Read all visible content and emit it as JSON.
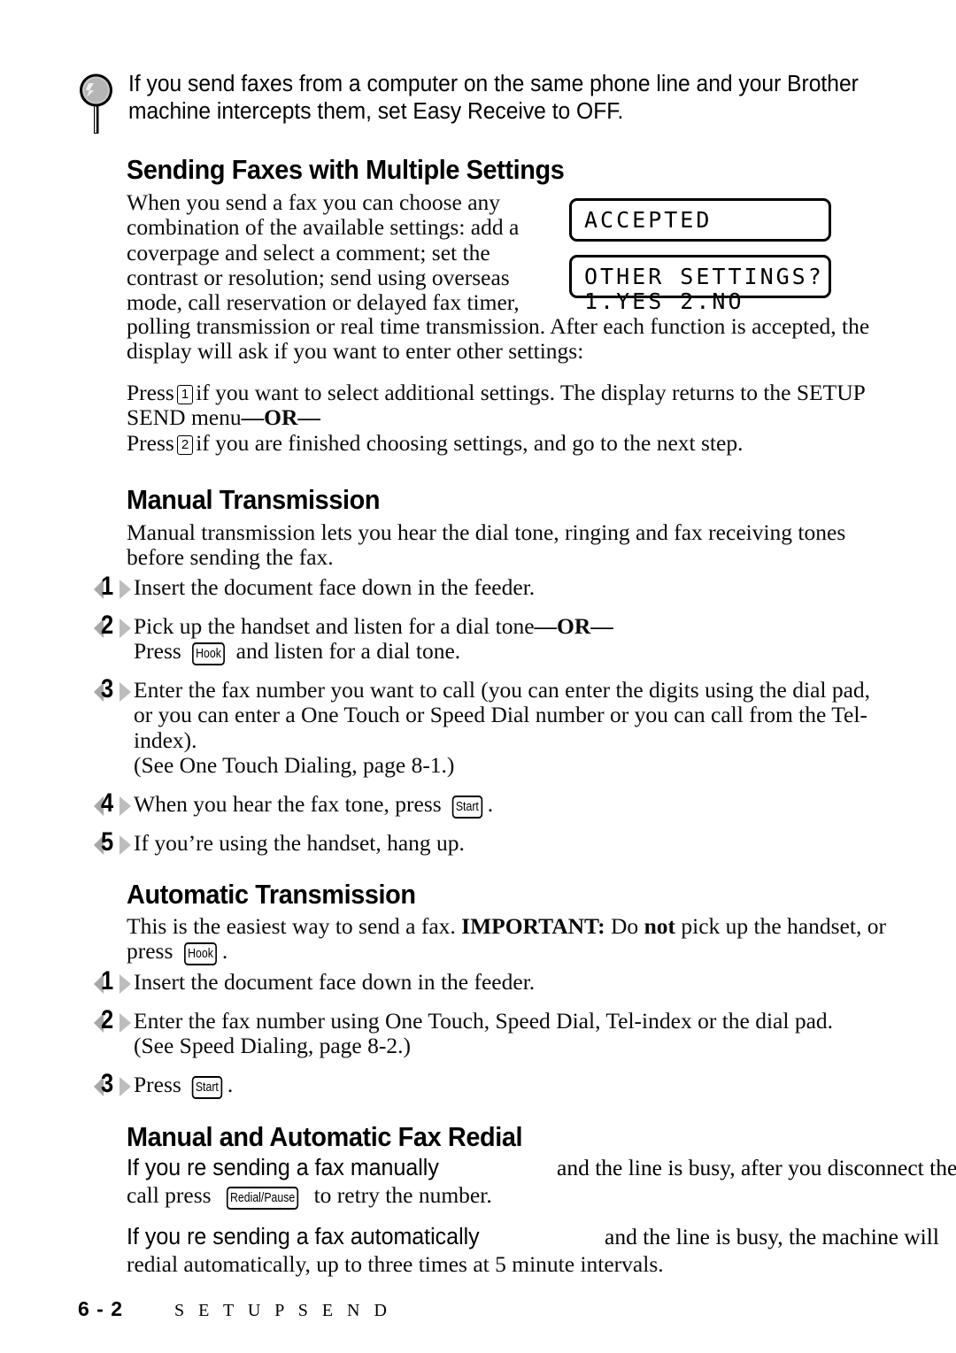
{
  "note": {
    "icon": "magnifier-icon",
    "lines": [
      "If you send faxes from a computer on the same phone line and your Brother",
      "machine intercepts them, set Easy Receive to OFF."
    ]
  },
  "sections": {
    "multiple_settings": {
      "heading": "Sending Faxes with Multiple Settings",
      "intro_narrow": "When you send a fax you can choose any combination of the available settings:  add a coverpage and select a comment; set the contrast or resolution; send using overseas mode, call reservation or delayed fax timer,",
      "intro_wide": "polling transmission or real time transmission. After each function is accepted, the display will ask if you want to enter other settings:",
      "press_1_pre": "Press",
      "press_1_key": "1",
      "press_1_post": "if you want to select additional settings. The display returns to the SETUP SEND menu",
      "or_label": "—OR—",
      "press_2_pre": "Press",
      "press_2_key": "2",
      "press_2_post": "if you are finished choosing settings, and go to the next step."
    },
    "lcd_displays": [
      {
        "name": "accepted-display",
        "lines": [
          "ACCEPTED"
        ]
      },
      {
        "name": "other-settings-display",
        "lines": [
          "OTHER SETTINGS?",
          "1.YES 2.NO"
        ]
      }
    ],
    "manual_transmission": {
      "heading": "Manual Transmission",
      "intro": "Manual transmission lets you hear the dial tone, ringing and fax receiving tones before sending the fax.",
      "steps": [
        {
          "num": "1",
          "parts": [
            {
              "t": "text",
              "v": "Insert the document face down in the feeder."
            }
          ]
        },
        {
          "num": "2",
          "parts": [
            {
              "t": "text",
              "v": "Pick up the handset and listen for a dial tone"
            },
            {
              "t": "bold",
              "v": "—OR—"
            },
            {
              "t": "br"
            },
            {
              "t": "text",
              "v": "Press "
            },
            {
              "t": "key",
              "v": "Hook"
            },
            {
              "t": "text",
              "v": " and listen for a dial tone."
            }
          ]
        },
        {
          "num": "3",
          "parts": [
            {
              "t": "text",
              "v": "Enter the fax number you want to call (you can enter the digits using the dial pad, or you can enter a One Touch or Speed Dial number or you can call from the Tel-index)."
            },
            {
              "t": "br"
            },
            {
              "t": "text",
              "v": "(See One Touch Dialing, page 8-1.)"
            }
          ]
        },
        {
          "num": "4",
          "parts": [
            {
              "t": "text",
              "v": "When you hear the fax tone, press "
            },
            {
              "t": "key",
              "v": "Start"
            },
            {
              "t": "text",
              "v": "."
            }
          ]
        },
        {
          "num": "5",
          "parts": [
            {
              "t": "text",
              "v": "If you’re using the handset, hang up."
            }
          ]
        }
      ]
    },
    "automatic_transmission": {
      "heading": "Automatic Transmission",
      "intro_parts": [
        {
          "t": "text",
          "v": "This is the easiest way to send a fax. "
        },
        {
          "t": "bold",
          "v": "IMPORTANT:"
        },
        {
          "t": "text",
          "v": " Do "
        },
        {
          "t": "bold",
          "v": "not"
        },
        {
          "t": "text",
          "v": " pick up the handset, or press "
        },
        {
          "t": "key",
          "v": "Hook"
        },
        {
          "t": "text",
          "v": "."
        }
      ],
      "steps": [
        {
          "num": "1",
          "parts": [
            {
              "t": "text",
              "v": "Insert the document face down in the feeder."
            }
          ]
        },
        {
          "num": "2",
          "parts": [
            {
              "t": "text",
              "v": "Enter the fax number using One Touch, Speed Dial, Tel-index or the dial pad."
            },
            {
              "t": "br"
            },
            {
              "t": "text",
              "v": "(See Speed Dialing, page 8-2.)"
            }
          ]
        },
        {
          "num": "3",
          "parts": [
            {
              "t": "text",
              "v": "Press "
            },
            {
              "t": "key",
              "v": "Start"
            },
            {
              "t": "text",
              "v": "."
            }
          ]
        }
      ]
    },
    "fax_redial": {
      "heading": "Manual and Automatic Fax Redial",
      "para1_sans": "If you re sending a fax manually",
      "para1_serif": "and the line is busy, after you disconnect the",
      "para1_line2_pre": "call press ",
      "para1_key": "Redial/Pause",
      "para1_line2_post": " to retry the number.",
      "para2_sans": "If you re sending a fax automatically",
      "para2_serif": "and the line is busy, the machine will",
      "para2_line2": "redial automatically, up to three times at 5 minute intervals."
    }
  },
  "footer": {
    "page_number": "6 - 2",
    "section_label": "S E T U P   S E N D"
  }
}
